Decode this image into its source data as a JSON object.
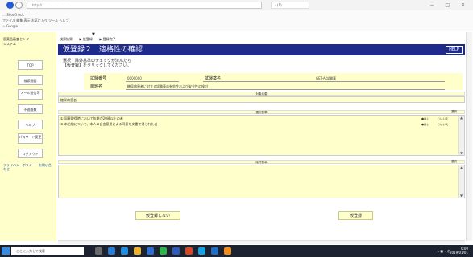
{
  "browser": {
    "address_text": "http://………………………",
    "tab_label": "・(1)",
    "right_chip": "",
    "window_controls": "− □ ✕"
  },
  "menubar": {
    "line1": "… ShotCheck",
    "line2": "ファイル 編集 表示 お気に入り ツール ヘルプ",
    "line3": "☆ Google"
  },
  "sidebar": {
    "title_lines": [
      "医薬品審査センター",
      "システム"
    ],
    "buttons": [
      {
        "label": "TOP"
      },
      {
        "label": "検索画面"
      },
      {
        "label": "メール送信等"
      },
      {
        "label": "不適格数"
      },
      {
        "label": "ヘルプ"
      },
      {
        "label": "パスワード変更"
      },
      {
        "label": "ログアウト"
      }
    ],
    "link_text": "プライバシーポリシー・お問い合わせ"
  },
  "breadcrumb": {
    "text": "検索結果 ───▶ 仮登録 ───▶ 登録完了",
    "marker": "▼"
  },
  "header": {
    "title": "仮登録２　適格性の確認",
    "help_label": "HELP"
  },
  "instructions": {
    "line1": "選択・除外基準のチェックが済んだら",
    "line2": "【仮登録】をクリックしてください。"
  },
  "trial_info": {
    "id_label": "試験番号",
    "id_value": "0000000",
    "drug_label": "試験薬名",
    "drug_value": "GET-A 試験薬",
    "title_label": "課題名",
    "title_value": "糖尿病患者に対する試験薬の有効性および安全性の検討"
  },
  "target_disease": {
    "header": "対象疾患",
    "value": "糖尿病患者"
  },
  "selection_criteria": {
    "header": "選択基準",
    "col_label": "選択",
    "items": [
      {
        "text": "① 同意取得時において年齢が20歳以上の者",
        "yes": "●はい",
        "no": "○いいえ"
      },
      {
        "text": "② 本治験について、本人の自由意思による同意を文書で得られた者",
        "yes": "●はい",
        "no": "○いいえ"
      }
    ]
  },
  "exclusion_criteria": {
    "header": "除外基準",
    "col_label": "選択"
  },
  "actions": {
    "no_register": "仮登録しない",
    "register": "仮登録"
  },
  "taskbar": {
    "search_placeholder": "ここに入力して検索",
    "tray": "∧ ■ ⌁ あ",
    "time": "0:00",
    "date": "2019/01/01"
  },
  "colors": {
    "header_blue": "#1e2a8c",
    "panel_yellow": "#ffffcc",
    "taskbar": "#1c2230"
  }
}
